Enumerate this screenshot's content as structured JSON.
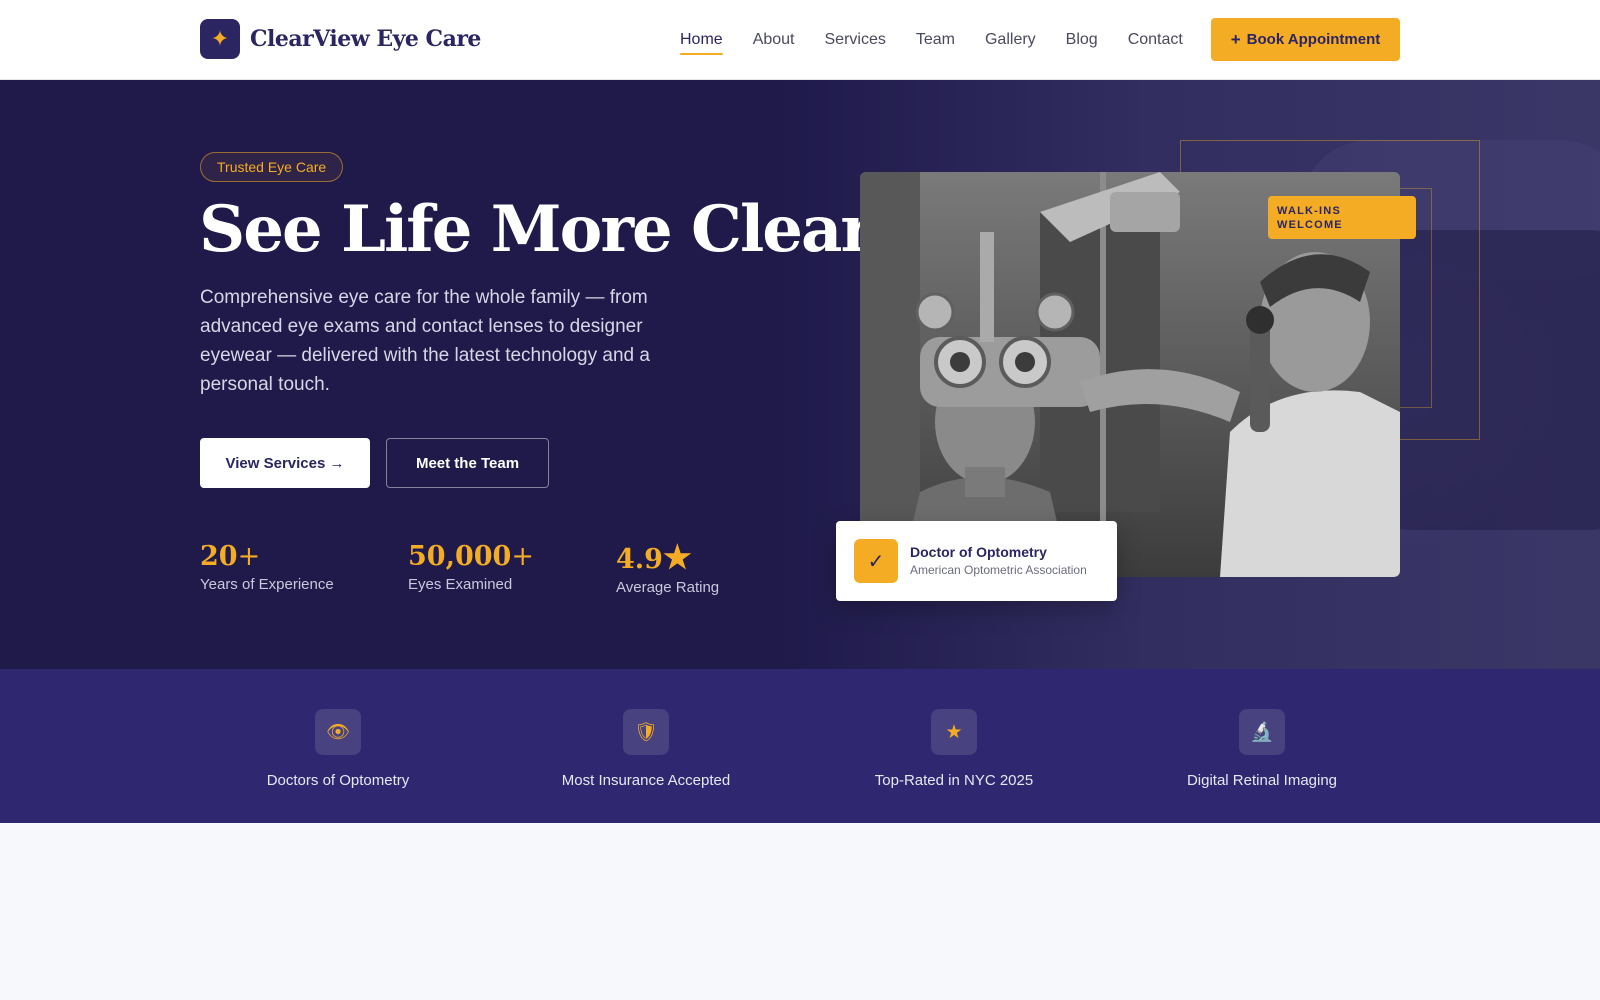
{
  "nav": {
    "logo_mark": "✦",
    "brand": "ClearView Eye Care",
    "links": [
      {
        "label": "Home",
        "active": true
      },
      {
        "label": "About"
      },
      {
        "label": "Services"
      },
      {
        "label": "Team"
      },
      {
        "label": "Gallery"
      },
      {
        "label": "Blog"
      },
      {
        "label": "Contact"
      }
    ],
    "cta_icon": "+",
    "cta_label": "Book Appointment"
  },
  "hero": {
    "badge": "Trusted Eye Care",
    "title": "See Life More Clearly",
    "description": "Comprehensive eye care for the whole family — from advanced eye exams and contact lenses to designer eyewear — delivered with the latest technology and a personal touch.",
    "primary_button": "View Services →",
    "secondary_button": "Meet the Team",
    "stats": [
      {
        "value": "20",
        "suffix": "+",
        "label": "Years of Experience"
      },
      {
        "value": "50,000",
        "suffix": "+",
        "label": "Eyes Examined"
      },
      {
        "value": "4.9",
        "suffix": "★",
        "label": "Average Rating"
      }
    ],
    "photo_tag": {
      "line1": "WALK-INS",
      "line2": "WELCOME"
    },
    "credential": {
      "icon": "✓",
      "title": "Doctor of Optometry",
      "subtitle": "American Optometric Association"
    }
  },
  "features": [
    {
      "icon": "eye-icon",
      "glyph": "👁",
      "label": "Doctors of Optometry"
    },
    {
      "icon": "shield-icon",
      "glyph": "🛡",
      "label": "Most Insurance Accepted"
    },
    {
      "icon": "star-icon",
      "glyph": "★",
      "label": "Top-Rated in NYC 2025"
    },
    {
      "icon": "microscope-icon",
      "glyph": "🔬",
      "label": "Digital Retinal Imaging"
    }
  ],
  "colors": {
    "brand_navy": "#2b2562",
    "hero_bg": "#1f1a4a",
    "features_bg": "#2f2870",
    "accent_gold": "#f5ac25"
  }
}
